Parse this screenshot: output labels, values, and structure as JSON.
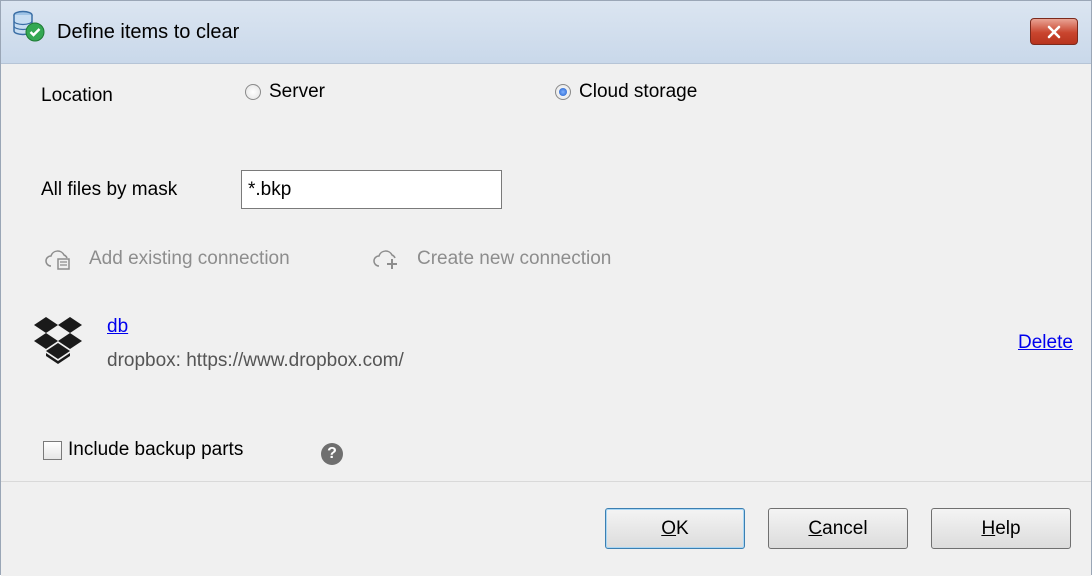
{
  "window": {
    "title": "Define items to clear"
  },
  "location": {
    "label": "Location",
    "options": [
      {
        "label": "Server",
        "selected": false
      },
      {
        "label": "Cloud storage",
        "selected": true
      }
    ]
  },
  "mask": {
    "label": "All files by mask",
    "value": "*.bkp"
  },
  "actions": {
    "add_existing": "Add existing connection",
    "create_new": "Create new connection"
  },
  "connection": {
    "name": "db",
    "description": "dropbox: https://www.dropbox.com/",
    "delete_label": "Delete",
    "icon": "dropbox-icon"
  },
  "include_parts": {
    "label": "Include backup parts",
    "checked": false
  },
  "buttons": {
    "ok_first": "O",
    "ok_rest": "K",
    "cancel_first": "C",
    "cancel_rest": "ancel",
    "help_first": "H",
    "help_rest": "elp"
  },
  "colors": {
    "link": "#0000ee",
    "disabled_text": "#8d8d8d",
    "close_button": "#c9452e"
  }
}
